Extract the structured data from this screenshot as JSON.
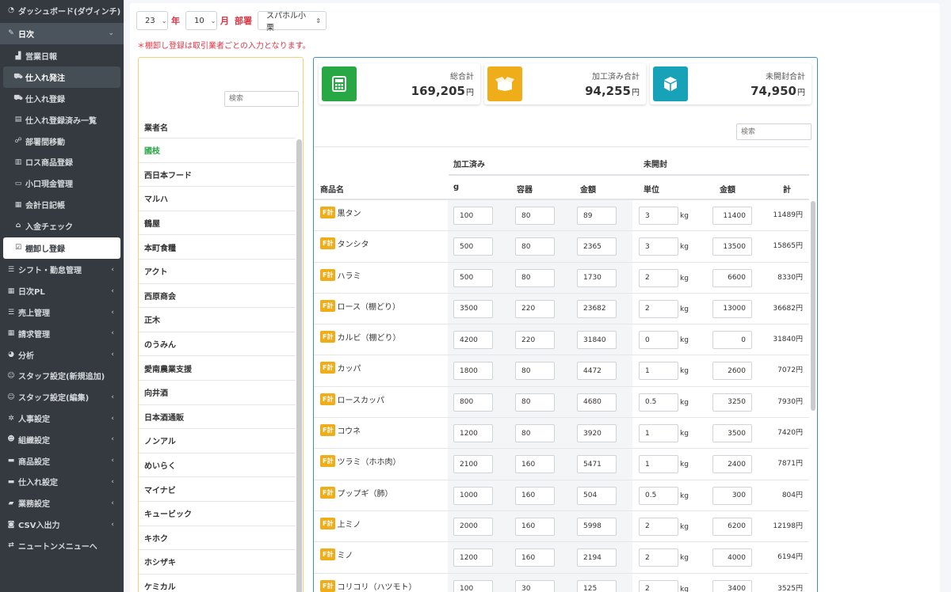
{
  "sidebar": {
    "items": [
      {
        "label": "ダッシュボード(ダヴィンチ)",
        "icon": "dashboard-icon",
        "sub": false,
        "state": "normal",
        "chevron": false
      },
      {
        "label": "日次",
        "icon": "edit-icon",
        "sub": false,
        "state": "open",
        "chevron": true
      },
      {
        "label": "営業日報",
        "icon": "chart-icon",
        "sub": true,
        "state": "normal",
        "chevron": false
      },
      {
        "label": "仕入れ発注",
        "icon": "truck-icon",
        "sub": true,
        "state": "highlight",
        "chevron": false
      },
      {
        "label": "仕入れ登録",
        "icon": "truck-icon",
        "sub": true,
        "state": "normal",
        "chevron": false
      },
      {
        "label": "仕入れ登録済み一覧",
        "icon": "clipboard-icon",
        "sub": true,
        "state": "normal",
        "chevron": false
      },
      {
        "label": "部署間移動",
        "icon": "people-icon",
        "sub": true,
        "state": "normal",
        "chevron": false
      },
      {
        "label": "ロス商品登録",
        "icon": "trash-icon",
        "sub": true,
        "state": "normal",
        "chevron": false
      },
      {
        "label": "小口現金管理",
        "icon": "wallet-icon",
        "sub": true,
        "state": "normal",
        "chevron": false
      },
      {
        "label": "会計日記帳",
        "icon": "book-icon",
        "sub": true,
        "state": "normal",
        "chevron": false
      },
      {
        "label": "入金チェック",
        "icon": "bank-icon",
        "sub": true,
        "state": "normal",
        "chevron": false
      },
      {
        "label": "棚卸し登録",
        "icon": "clipboard-check-icon",
        "sub": true,
        "state": "active",
        "chevron": false
      },
      {
        "label": "シフト・勤怠管理",
        "icon": "list-icon",
        "sub": false,
        "state": "normal",
        "chevron": true
      },
      {
        "label": "日次PL",
        "icon": "calculator-icon",
        "sub": false,
        "state": "normal",
        "chevron": true
      },
      {
        "label": "売上管理",
        "icon": "list-icon",
        "sub": false,
        "state": "normal",
        "chevron": true
      },
      {
        "label": "請求管理",
        "icon": "calendar-icon",
        "sub": false,
        "state": "normal",
        "chevron": true
      },
      {
        "label": "分析",
        "icon": "pie-icon",
        "sub": false,
        "state": "normal",
        "chevron": true
      },
      {
        "label": "スタッフ設定(新規追加)",
        "icon": "user-plus-icon",
        "sub": false,
        "state": "normal",
        "chevron": false
      },
      {
        "label": "スタッフ設定(編集)",
        "icon": "user-edit-icon",
        "sub": false,
        "state": "normal",
        "chevron": true
      },
      {
        "label": "人事設定",
        "icon": "gear-icon",
        "sub": false,
        "state": "normal",
        "chevron": true
      },
      {
        "label": "組織設定",
        "icon": "users-icon",
        "sub": false,
        "state": "normal",
        "chevron": true
      },
      {
        "label": "商品設定",
        "icon": "store-icon",
        "sub": false,
        "state": "normal",
        "chevron": true
      },
      {
        "label": "仕入れ設定",
        "icon": "store-icon",
        "sub": false,
        "state": "normal",
        "chevron": true
      },
      {
        "label": "業務設定",
        "icon": "briefcase-icon",
        "sub": false,
        "state": "normal",
        "chevron": true
      },
      {
        "label": "CSV入出力",
        "icon": "database-icon",
        "sub": false,
        "state": "normal",
        "chevron": true
      },
      {
        "label": "ニュートンメニューへ",
        "icon": "exchange-icon",
        "sub": false,
        "state": "normal",
        "chevron": false
      }
    ]
  },
  "filters": {
    "year": "23",
    "year_label": "年",
    "month": "10",
    "month_label": "月",
    "dept_label": "部署",
    "dept": "スパホル小栗"
  },
  "notice": "＊棚卸し登録は取引業者ごとの入力となります。",
  "vendors": {
    "search_placeholder": "検索",
    "header": "業者名",
    "items": [
      "國枝",
      "西日本フード",
      "マルハ",
      "鶴屋",
      "本町食糧",
      "アクト",
      "西原商会",
      "正木",
      "のうみん",
      "愛南農業支援",
      "向井酒",
      "日本酒通販",
      "ノンアル",
      "めいらく",
      "マイナビ",
      "キュービック",
      "キホク",
      "ホシザキ",
      "ケミカル"
    ],
    "selected_index": 0
  },
  "summary": {
    "total": {
      "label": "総合計",
      "value": "169,205",
      "unit": "円",
      "color": "#28a745",
      "icon": "calculator-icon"
    },
    "processed": {
      "label": "加工済み合計",
      "value": "94,255",
      "unit": "円",
      "color": "#f0ad1a",
      "icon": "box-open-icon"
    },
    "unopened": {
      "label": "未開封合計",
      "value": "74,950",
      "unit": "円",
      "color": "#17a2b8",
      "icon": "cube-icon"
    }
  },
  "table": {
    "search_placeholder": "検索",
    "group_processed": "加工済み",
    "group_unopened": "未開封",
    "columns": {
      "name": "商品名",
      "g": "g",
      "container": "容器",
      "amount": "金額",
      "unit": "単位",
      "amount2": "金額",
      "total": "計"
    },
    "badge": "F計",
    "unit_suffix": "kg",
    "rows": [
      {
        "name": "黒タン",
        "g": "100",
        "container": "80",
        "amount": "89",
        "unit": "3",
        "amount2": "11400",
        "total": "11489円"
      },
      {
        "name": "タンシタ",
        "g": "500",
        "container": "80",
        "amount": "2365",
        "unit": "3",
        "amount2": "13500",
        "total": "15865円"
      },
      {
        "name": "ハラミ",
        "g": "500",
        "container": "80",
        "amount": "1730",
        "unit": "2",
        "amount2": "6600",
        "total": "8330円"
      },
      {
        "name": "ロース（棚どり）",
        "g": "3500",
        "container": "220",
        "amount": "23682",
        "unit": "2",
        "amount2": "13000",
        "total": "36682円"
      },
      {
        "name": "カルビ（棚どり）",
        "g": "4200",
        "container": "220",
        "amount": "31840",
        "unit": "0",
        "amount2": "0",
        "total": "31840円"
      },
      {
        "name": "カッパ",
        "g": "1800",
        "container": "80",
        "amount": "4472",
        "unit": "1",
        "amount2": "2600",
        "total": "7072円"
      },
      {
        "name": "ロースカッパ",
        "g": "800",
        "container": "80",
        "amount": "4680",
        "unit": "0.5",
        "amount2": "3250",
        "total": "7930円"
      },
      {
        "name": "コウネ",
        "g": "1200",
        "container": "80",
        "amount": "3920",
        "unit": "1",
        "amount2": "3500",
        "total": "7420円"
      },
      {
        "name": "ツラミ（ホホ肉）",
        "g": "2100",
        "container": "160",
        "amount": "5471",
        "unit": "1",
        "amount2": "2400",
        "total": "7871円"
      },
      {
        "name": "プップギ（肺）",
        "g": "1000",
        "container": "160",
        "amount": "504",
        "unit": "0.5",
        "amount2": "300",
        "total": "804円"
      },
      {
        "name": "上ミノ",
        "g": "2000",
        "container": "160",
        "amount": "5998",
        "unit": "2",
        "amount2": "6200",
        "total": "12198円"
      },
      {
        "name": "ミノ",
        "g": "1200",
        "container": "160",
        "amount": "2194",
        "unit": "2",
        "amount2": "4000",
        "total": "6194円"
      },
      {
        "name": "コリコリ（ハツモト）",
        "g": "100",
        "container": "30",
        "amount": "125",
        "unit": "2",
        "amount2": "3400",
        "total": "3525円"
      }
    ]
  }
}
